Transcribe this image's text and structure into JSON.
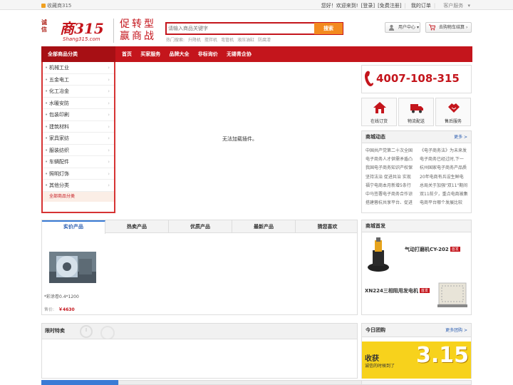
{
  "topbar": {
    "favorite": "收藏商315",
    "greeting": "您好！欢迎来到!",
    "login": "[登录]",
    "register": "[免费注册]",
    "my_orders": "我的订单",
    "service": "客户服务"
  },
  "header": {
    "logo_side": "诚信",
    "logo_main": "商315",
    "logo_sub": "Shang315.com",
    "slogan_line1": "促转型",
    "slogan_line2": "赢商战",
    "search_placeholder": "请输入商品关键字",
    "search_button": "搜索",
    "hot_label": "热门搜索:",
    "hot_words": [
      "升降机",
      "搅拌机",
      "弯管机",
      "液压油缸",
      "防腐漆"
    ],
    "user_center": "用户中心",
    "cart": "去购物车结算"
  },
  "nav": {
    "all_categories": "全部商品分类",
    "items": [
      "首页",
      "买家服务",
      "品牌大全",
      "非标询价",
      "无锡青企协"
    ]
  },
  "categories": {
    "items": [
      "机械工业",
      "五金电工",
      "化工冶金",
      "水暖安防",
      "包装印刷",
      "建筑材料",
      "家具家纺",
      "服装纺织",
      "车辆配件",
      "照明灯饰",
      "其他分类"
    ],
    "all_link": "全部商品分类"
  },
  "banner": {
    "plugin_message": "无法加载插件。"
  },
  "hotline": {
    "number": "4007-108-315"
  },
  "services": [
    {
      "label": "在线订货",
      "icon": "house-icon"
    },
    {
      "label": "物流配送",
      "icon": "truck-icon"
    },
    {
      "label": "售后服务",
      "icon": "handshake-icon"
    }
  ],
  "news": {
    "title": "商城动态",
    "more": "更多 >",
    "col1": [
      "中国共产党第二十次全国",
      "电子商务人才供需矛盾凸",
      "我国电子商务知识产权保",
      "坚持法治 促进共治 实现",
      "福宁电商本月新增5条行",
      "中马签署电子商务合作谅",
      "搭建蓉杭共享平台、促进"
    ],
    "col2": [
      "《电子商务法》为未来发",
      "电子商务已经过时,下一",
      "杭州国家电子商务产品质",
      "20年电商有兵设生鲜电",
      "总局关于加强\"双11\"期间",
      "双11前夕，重点电商被集",
      "电商平台哪个发展比较"
    ]
  },
  "product_tabs": {
    "tabs": [
      "实价产品",
      "热卖产品",
      "优质产品",
      "最新产品",
      "猜您喜欢"
    ],
    "active_index": 0
  },
  "product": {
    "name": "*彩涂卷0.4*1200",
    "price_label": "售价:",
    "price": "￥4630"
  },
  "shop_first": {
    "title": "商城首发",
    "items": [
      {
        "name": "气动打磨机CY-202",
        "badge": "首发"
      },
      {
        "name": "XN224三相阻用发电机",
        "badge": "首发"
      }
    ]
  },
  "limited": {
    "title": "限时特卖"
  },
  "group_buy": {
    "title": "今日团购",
    "more": "更多团购 >",
    "banner_line1": "收获",
    "banner_line2": "诚信的时候到了",
    "banner_date": "3.15"
  },
  "colors": {
    "brand_red": "#c4151c",
    "accent_orange": "#f38a1f",
    "tab_blue": "#3a7bd5"
  }
}
